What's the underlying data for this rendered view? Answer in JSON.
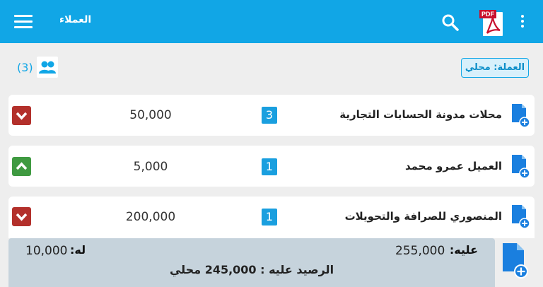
{
  "appbar": {
    "title": "العملاء",
    "pdf_label": "PDF",
    "bg_color": "#11a6e6"
  },
  "icons": {
    "menu": "hamburger-menu-icon",
    "search": "search-icon",
    "pdf": "pdf-file-icon",
    "more": "more-vert-icon",
    "users": "users-group-icon",
    "doc_add": "document-add-icon"
  },
  "toolbar": {
    "count": "(3)",
    "currency_label": "العملة: محلي"
  },
  "customers": [
    {
      "name": "محلات مدونة الحسابات التجارية",
      "badge": "3",
      "amount": "50,000",
      "trend": "down"
    },
    {
      "name": "العميل عمرو محمد",
      "badge": "1",
      "amount": "5,000",
      "trend": "up"
    },
    {
      "name": "المنصوري للصرافة والتحويلات",
      "badge": "1",
      "amount": "200,000",
      "trend": "down"
    }
  ],
  "summary": {
    "debit_label": "عليه:",
    "debit_value": "255,000",
    "credit_label": "له:",
    "credit_value": "10,000",
    "balance": "الرصيد عليه : 245,000 محلي"
  },
  "colors": {
    "accent": "#11a6e6",
    "badge": "#1a9fdf",
    "down": "#b3302b",
    "up": "#3f9a41",
    "summary_bg": "#c6d3dc"
  }
}
